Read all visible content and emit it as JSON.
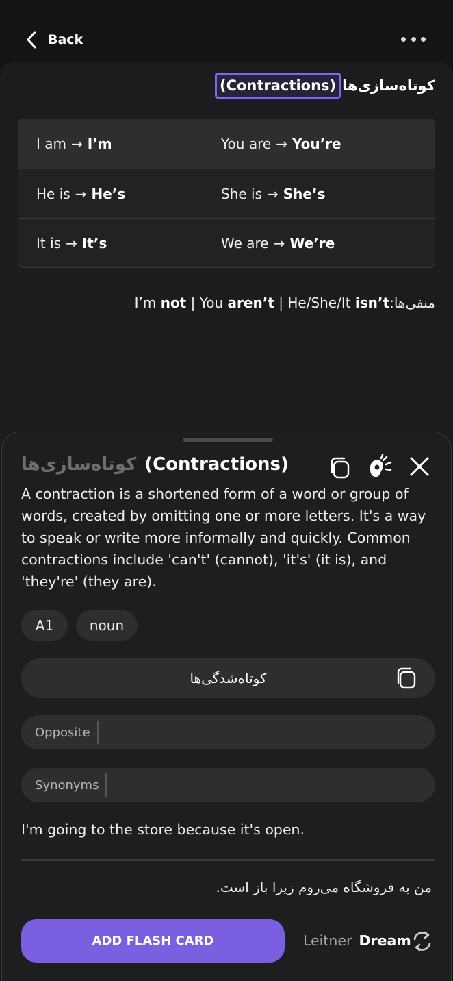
{
  "header": {
    "back_label": "Back"
  },
  "lesson": {
    "heading_fa": "کوتاه‌سازی‌ها",
    "heading_en": "(Contractions)",
    "table": [
      [
        {
          "full": "I am",
          "short": "I’m"
        },
        {
          "full": "You are",
          "short": "You’re"
        }
      ],
      [
        {
          "full": "He is",
          "short": "He’s"
        },
        {
          "full": "She is",
          "short": "She’s"
        }
      ],
      [
        {
          "full": "It is",
          "short": "It’s"
        },
        {
          "full": "We are",
          "short": "We’re"
        }
      ]
    ],
    "arrow": "→",
    "negatives": {
      "label_fa": "منفی‌ها:",
      "p1_plain": "I’m ",
      "p1_bold": "not",
      "sep": " | ",
      "p2_plain": "You ",
      "p2_bold": "aren’t",
      "p3_plain": "He/She/It ",
      "p3_bold": "isn’t"
    }
  },
  "sheet": {
    "title_fa": "کوتاه‌سازی‌ها",
    "title_en": "(Contractions)",
    "definition": "A contraction is a shortened form of a word or group of words, created by omitting one or more letters. It's a way to speak or write more informally and quickly. Common contractions include 'can't' (cannot), 'it's' (it is), and 'they're' (they are).",
    "level": "A1",
    "part_of_speech": "noun",
    "translation": "کوتاه‌شدگی‌ها",
    "opposite_label": "Opposite",
    "opposite_value": "",
    "synonyms_label": "Synonyms",
    "synonyms_value": "",
    "example_en": "I'm going to the store because it's open.",
    "example_fa": "من به فروشگاه می‌روم زیرا باز است.",
    "add_button": "ADD FLASH CARD",
    "leitner_label": "Leitner",
    "leitner_box": "Dream"
  },
  "colors": {
    "accent": "#7a5fe0",
    "highlight_border": "#7b68ee",
    "background": "#141416",
    "sheet": "#1e1e20"
  },
  "icons": [
    "chevron-left-icon",
    "more-dots-icon",
    "copy-icon",
    "speaker-icon",
    "close-icon",
    "refresh-icon"
  ]
}
